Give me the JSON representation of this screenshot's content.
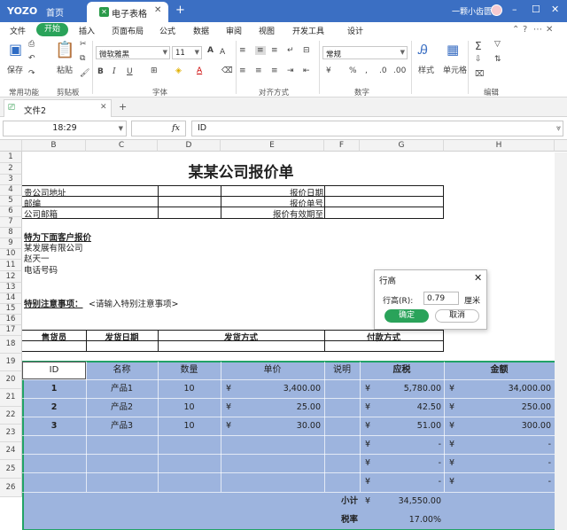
{
  "topbar": {
    "logo": "YOZO",
    "home": "首页",
    "doc_tab": "电子表格",
    "user": "一颗小齿匮"
  },
  "menu": {
    "file": "文件",
    "start": "开始",
    "items": [
      "插入",
      "页面布局",
      "公式",
      "数据",
      "审阅",
      "视图",
      "开发工具",
      "设计"
    ]
  },
  "ribbon": {
    "save": "保存",
    "paste": "粘贴",
    "font_name": "微软雅黑",
    "font_size": "11",
    "number_format": "常规",
    "style": "样式",
    "cell": "单元格",
    "groups": [
      "常用功能",
      "剪贴板",
      "字体",
      "对齐方式",
      "数字",
      "编辑"
    ]
  },
  "file_tab": "文件2",
  "formula": {
    "cell_ref": "18:29",
    "fx": "fx",
    "content": "ID"
  },
  "columns": [
    "B",
    "C",
    "D",
    "E",
    "F",
    "G",
    "H"
  ],
  "rows": [
    "1",
    "2",
    "3",
    "4",
    "5",
    "6",
    "7",
    "8",
    "9",
    "10",
    "11",
    "12",
    "13",
    "14",
    "15",
    "16",
    "17",
    "18",
    "19",
    "20",
    "21",
    "22",
    "23",
    "24",
    "25",
    "26"
  ],
  "sheet": {
    "title": "某某公司报价单",
    "info_left": [
      "贵公司地址",
      "邮编",
      "公司邮箱"
    ],
    "info_right": [
      "报价日期",
      "报价单号",
      "报价有效期至"
    ],
    "customer_heading": "特为下面客户报价",
    "customer_lines": [
      "某发展有限公司",
      "赵天一",
      "电话号码"
    ],
    "note_label": "特别注意事项：",
    "note_text": "<请输入特别注意事项>",
    "seller_headers": [
      "售货员",
      "发货日期",
      "发货方式",
      "付款方式"
    ],
    "table_headers": [
      "ID",
      "名称",
      "数量",
      "单价",
      "说明",
      "应税",
      "金额"
    ],
    "rows": [
      {
        "id": "1",
        "name": "产品1",
        "qty": "10",
        "price": "3,400.00",
        "tax": "5,780.00",
        "amount": "34,000.00"
      },
      {
        "id": "2",
        "name": "产品2",
        "qty": "10",
        "price": "25.00",
        "tax": "42.50",
        "amount": "250.00"
      },
      {
        "id": "3",
        "name": "产品3",
        "qty": "10",
        "price": "30.00",
        "tax": "51.00",
        "amount": "300.00"
      }
    ],
    "currency": "¥",
    "dash": "-",
    "subtotal_label": "小计",
    "subtotal": "34,550.00",
    "tax_rate_label": "税率",
    "tax_rate": "17.00%"
  },
  "dialog": {
    "title": "行高",
    "label": "行高(R):",
    "value": "0.79",
    "unit": "厘米",
    "ok": "确定",
    "cancel": "取消"
  },
  "colors": {
    "accent": "#3b6fc3",
    "green": "#2aa35a",
    "selection": "#9db4de"
  }
}
